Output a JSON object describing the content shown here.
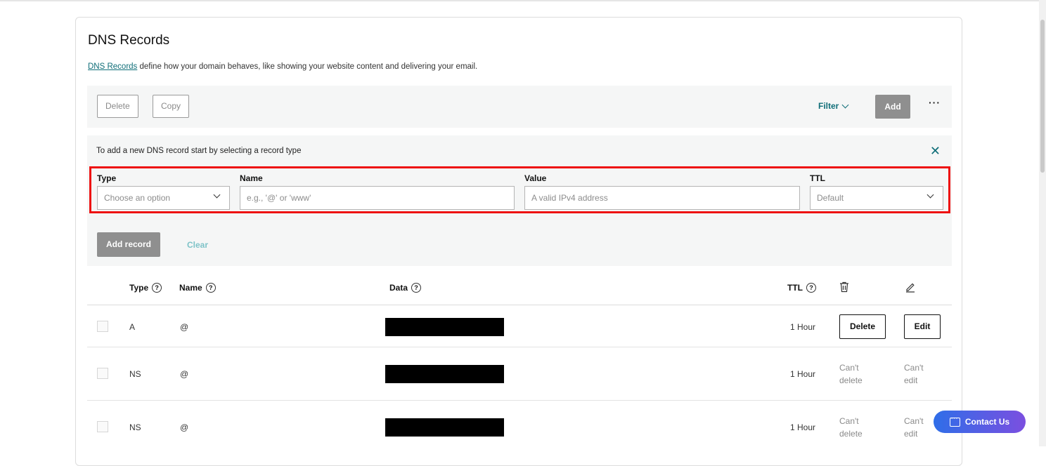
{
  "section": {
    "title": "DNS Records",
    "description_link": "DNS Records",
    "description_rest": " define how your domain behaves, like showing your website content and delivering your email."
  },
  "toolbar": {
    "delete_label": "Delete",
    "copy_label": "Copy",
    "filter_label": "Filter",
    "add_label": "Add",
    "more_label": "···"
  },
  "add_form": {
    "hint": "To add a new DNS record start by selecting a record type",
    "close_icon": "close-icon",
    "type_label": "Type",
    "type_placeholder": "Choose an option",
    "name_label": "Name",
    "name_placeholder": "e.g., '@' or 'www'",
    "value_label": "Value",
    "value_placeholder": "A valid IPv4 address",
    "ttl_label": "TTL",
    "ttl_value": "Default",
    "add_record_label": "Add record",
    "clear_label": "Clear"
  },
  "table": {
    "headers": {
      "type": "Type",
      "name": "Name",
      "data": "Data",
      "ttl": "TTL",
      "delete_icon": "trash-icon",
      "edit_icon": "pencil-icon"
    },
    "rows": [
      {
        "type": "A",
        "name": "@",
        "ttl": "1 Hour",
        "delete": "Delete",
        "edit": "Edit"
      },
      {
        "type": "NS",
        "name": "@",
        "ttl": "1 Hour",
        "delete_line1": "Can't",
        "delete_line2": "delete",
        "edit_line1": "Can't",
        "edit_line2": "edit"
      },
      {
        "type": "NS",
        "name": "@",
        "ttl": "1 Hour",
        "delete_line1": "Can't",
        "delete_line2": "delete",
        "edit_line1": "Can't",
        "edit_line2": "edit"
      }
    ]
  },
  "contact": {
    "label": "Contact Us"
  },
  "colors": {
    "accent": "#0f6e78",
    "highlight": "#ee1111",
    "disabled_button": "#8f8f8f"
  }
}
